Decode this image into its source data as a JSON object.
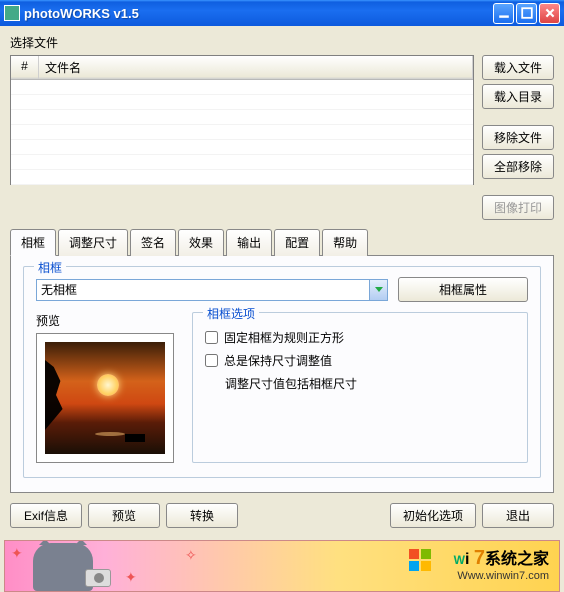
{
  "window": {
    "title": "photoWORKS v1.5"
  },
  "labels": {
    "select_file": "选择文件",
    "col_num": "#",
    "col_name": "文件名"
  },
  "side_buttons": {
    "load_file": "载入文件",
    "load_dir": "载入目录",
    "remove_file": "移除文件",
    "remove_all": "全部移除",
    "image_print": "图像打印"
  },
  "tabs": [
    "相框",
    "调整尺寸",
    "签名",
    "效果",
    "输出",
    "配置",
    "帮助"
  ],
  "frame_panel": {
    "legend": "相框",
    "combo_value": "无相框",
    "prop_button": "相框属性",
    "preview_label": "预览",
    "options_legend": "相框选项",
    "opt1": "固定相框为规则正方形",
    "opt2_line1": "总是保持尺寸调整值",
    "opt2_line2": "调整尺寸值包括相框尺寸"
  },
  "bottom": {
    "exif": "Exif信息",
    "preview": "预览",
    "convert": "转换",
    "init": "初始化选项",
    "exit": "退出"
  },
  "banner": {
    "brand_text": "Wi 7系统之家",
    "brand_url": "Www.winwin7.com"
  }
}
